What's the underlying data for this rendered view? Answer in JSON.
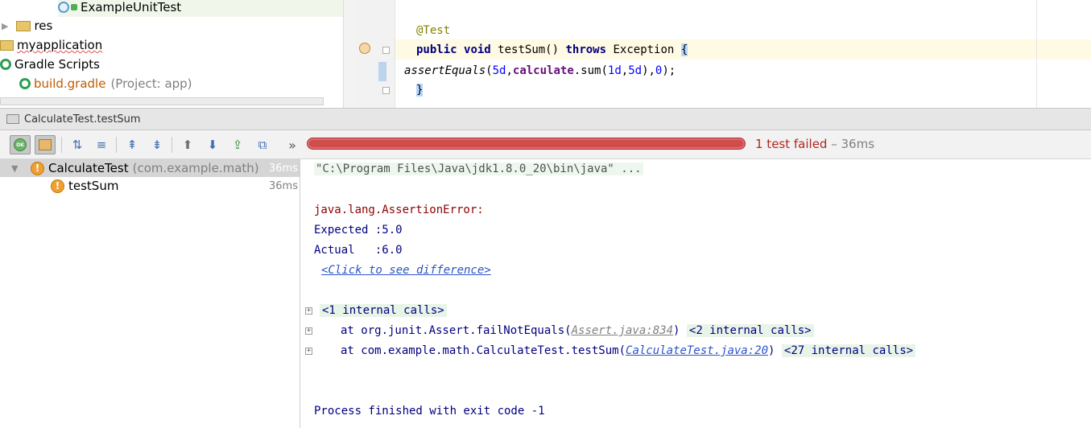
{
  "project_tree": {
    "items": [
      {
        "label": "ExampleUnitTest",
        "hint": ""
      },
      {
        "label": "res",
        "hint": ""
      },
      {
        "label": "myapplication",
        "hint": ""
      },
      {
        "label": "Gradle Scripts",
        "hint": ""
      },
      {
        "label": "build.gradle",
        "hint": "(Project: app)"
      }
    ]
  },
  "editor": {
    "lines": {
      "annotation": "@Test",
      "public": "public",
      "void": "void",
      "method": "testSum()",
      "throws": "throws",
      "exception": "Exception",
      "brace_open": "{",
      "assert_fn": "assertEquals",
      "assert_args_1": "(",
      "assert_num_1": "5d",
      "assert_comma_1": ",",
      "assert_field": "calculate",
      "assert_call": ".sum(",
      "assert_num_2": "1d",
      "assert_comma_2": ",",
      "assert_num_3": "5d",
      "assert_close": "),",
      "assert_num_4": "0",
      "assert_end": ");",
      "brace_close": "}"
    }
  },
  "run_window": {
    "tab_title": "CalculateTest.testSum",
    "more_label": "»",
    "status": {
      "failed_text": "1 test failed",
      "duration_text": " – 36ms"
    },
    "progress": {
      "fraction": 1.0
    }
  },
  "test_tree": {
    "rows": [
      {
        "name": "CalculateTest",
        "hint": "(com.example.math)",
        "duration": "36ms"
      },
      {
        "name": "testSum",
        "hint": "",
        "duration": "36ms"
      }
    ]
  },
  "console": {
    "command": "\"C:\\Program Files\\Java\\jdk1.8.0_20\\bin\\java\" ...",
    "error": "java.lang.AssertionError:",
    "expected": "Expected :5.0",
    "actual": "Actual   :6.0",
    "diff_link": "<Click to see difference>",
    "internal_1": "<1 internal calls>",
    "trace_1_prefix": "at org.junit.Assert.failNotEquals(",
    "trace_1_link": "Assert.java:834",
    "trace_1_suffix": ")",
    "trace_1_internal": "<2 internal calls>",
    "trace_2_prefix": "at com.example.math.CalculateTest.testSum(",
    "trace_2_link": "CalculateTest.java:20",
    "trace_2_suffix": ")",
    "trace_2_internal": "<27 internal calls>",
    "exit": "Process finished with exit code -1"
  },
  "colors": {
    "fail_red": "#cf4d4d",
    "status_text": "#b3261e",
    "console_text": "#000080",
    "warn_orange": "#f0a030"
  }
}
